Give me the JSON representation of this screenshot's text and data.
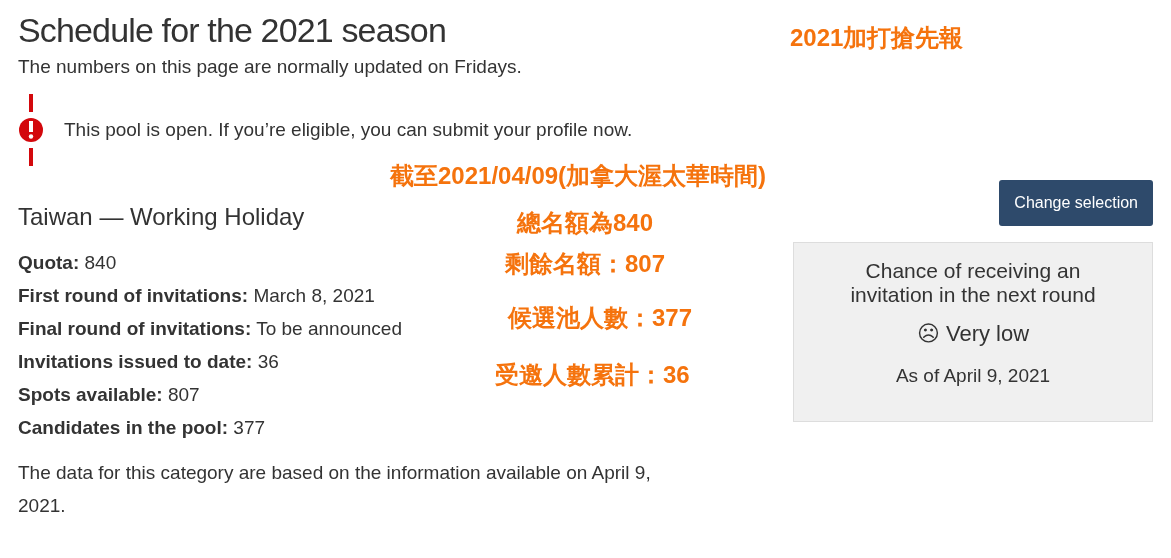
{
  "title": "Schedule for the 2021 season",
  "subtitle": "The numbers on this page are normally updated on Fridays.",
  "alert": {
    "kind": "warning",
    "text": "This pool is open. If you’re eligible, you can submit your profile now."
  },
  "category": {
    "title": "Taiwan — Working Holiday",
    "button": "Change selection",
    "facts": [
      {
        "label": "Quota:",
        "value": "840"
      },
      {
        "label": "First round of invitations:",
        "value": "March 8, 2021"
      },
      {
        "label": "Final round of invitations:",
        "value": "To be announced"
      },
      {
        "label": "Invitations issued to date:",
        "value": "36"
      },
      {
        "label": "Spots available:",
        "value": "807"
      },
      {
        "label": "Candidates in the pool:",
        "value": "377"
      }
    ],
    "note": "The data for this category are based on the information available on April 9, 2021."
  },
  "chance": {
    "heading": "Chance of receiving an invitation in the next round",
    "face": "☹",
    "rating": "Very low",
    "date": "As of April 9, 2021"
  },
  "annotations": [
    "2021加打搶先報",
    "截至2021/04/09(加拿大渥太華時間)",
    "總名額為840",
    "剩餘名額：807",
    "候選池人數：377",
    "受邀人數累計：36"
  ]
}
